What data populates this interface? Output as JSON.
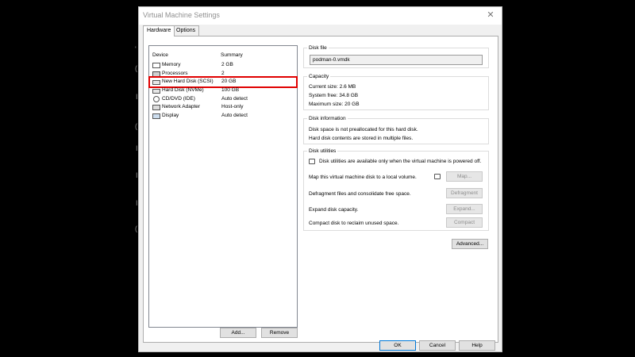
{
  "background": {
    "glyphs": [
      "'",
      "(",
      "I",
      "(",
      "I",
      "I",
      "I",
      "("
    ]
  },
  "window": {
    "title": "Virtual Machine Settings",
    "close_glyph": "✕"
  },
  "tabs": [
    {
      "label": "Hardware",
      "active": true
    },
    {
      "label": "Options",
      "active": false
    }
  ],
  "device_list": {
    "headers": {
      "device": "Device",
      "summary": "Summary"
    },
    "rows": [
      {
        "icon": "memory-icon",
        "name": "Memory",
        "summary": "2 GB",
        "selected": false
      },
      {
        "icon": "processor-icon",
        "name": "Processors",
        "summary": "2",
        "selected": false
      },
      {
        "icon": "hard-disk-icon",
        "name": "New Hard Disk (SCSI)",
        "summary": "20 GB",
        "selected": true
      },
      {
        "icon": "hard-disk-icon",
        "name": "Hard Disk (NVMe)",
        "summary": "100 GB",
        "selected": false
      },
      {
        "icon": "cd-dvd-icon",
        "name": "CD/DVD (IDE)",
        "summary": "Auto detect",
        "selected": false
      },
      {
        "icon": "network-adapter-icon",
        "name": "Network Adapter",
        "summary": "Host-only",
        "selected": false
      },
      {
        "icon": "display-icon",
        "name": "Display",
        "summary": "Auto detect",
        "selected": false
      }
    ],
    "add_label": "Add...",
    "remove_label": "Remove"
  },
  "disk_file": {
    "title": "Disk file",
    "value": "podman-0.vmdk"
  },
  "capacity": {
    "title": "Capacity",
    "current_size": "Current size: 2.6 MB",
    "system_free": "System free: 34.8 GB",
    "maximum_size": "Maximum size: 20 GB"
  },
  "disk_information": {
    "title": "Disk information",
    "line1": "Disk space is not preallocated for this hard disk.",
    "line2": "Hard disk contents are stored in multiple files."
  },
  "disk_utilities": {
    "title": "Disk utilities",
    "notice": "Disk utilities are available only when the virtual machine is powered off.",
    "map_text": "Map this virtual machine disk to a local volume.",
    "map_label": "Map...",
    "defrag_text": "Defragment files and consolidate free space.",
    "defrag_label": "Defragment",
    "expand_text": "Expand disk capacity.",
    "expand_label": "Expand...",
    "compact_text": "Compact disk to reclaim unused space.",
    "compact_label": "Compact"
  },
  "advanced_label": "Advanced...",
  "footer": {
    "ok_label": "OK",
    "cancel_label": "Cancel",
    "help_label": "Help"
  }
}
